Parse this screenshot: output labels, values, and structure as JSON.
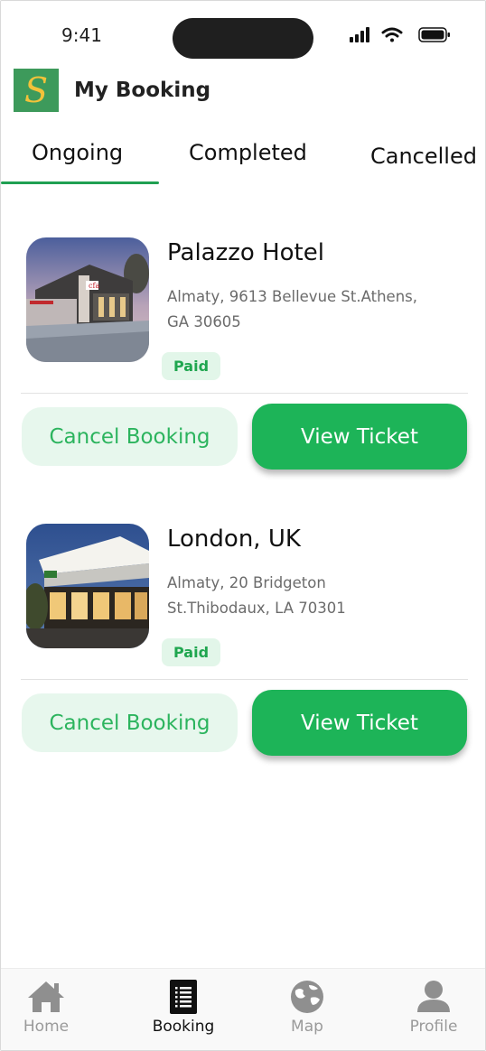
{
  "status_bar": {
    "time": "9:41"
  },
  "header": {
    "logo_letter": "S",
    "title": "My Booking"
  },
  "tabs": [
    {
      "label": "Ongoing",
      "active": true
    },
    {
      "label": "Completed",
      "active": false
    },
    {
      "label": "Cancelled",
      "active": false
    }
  ],
  "bookings": [
    {
      "name": "Palazzo Hotel",
      "address": "Almaty, 9613 Bellevue St.Athens, GA 30605",
      "status": "Paid",
      "cancel_label": "Cancel Booking",
      "view_label": "View Ticket"
    },
    {
      "name": "London, UK",
      "address": "Almaty, 20 Bridgeton St.Thibodaux, LA 70301",
      "status": "Paid",
      "cancel_label": "Cancel Booking",
      "view_label": "View Ticket"
    }
  ],
  "bottom_nav": [
    {
      "label": "Home",
      "icon": "home-icon",
      "active": false
    },
    {
      "label": "Booking",
      "icon": "booking-list-icon",
      "active": true
    },
    {
      "label": "Map",
      "icon": "globe-map-icon",
      "active": false
    },
    {
      "label": "Profile",
      "icon": "user-icon",
      "active": false
    }
  ],
  "colors": {
    "accent": "#1db458",
    "accent_light": "#e7f7ed",
    "paid_text": "#1fa64f",
    "logo_bg": "#3d9a5b",
    "logo_letter": "#f2c23a"
  }
}
